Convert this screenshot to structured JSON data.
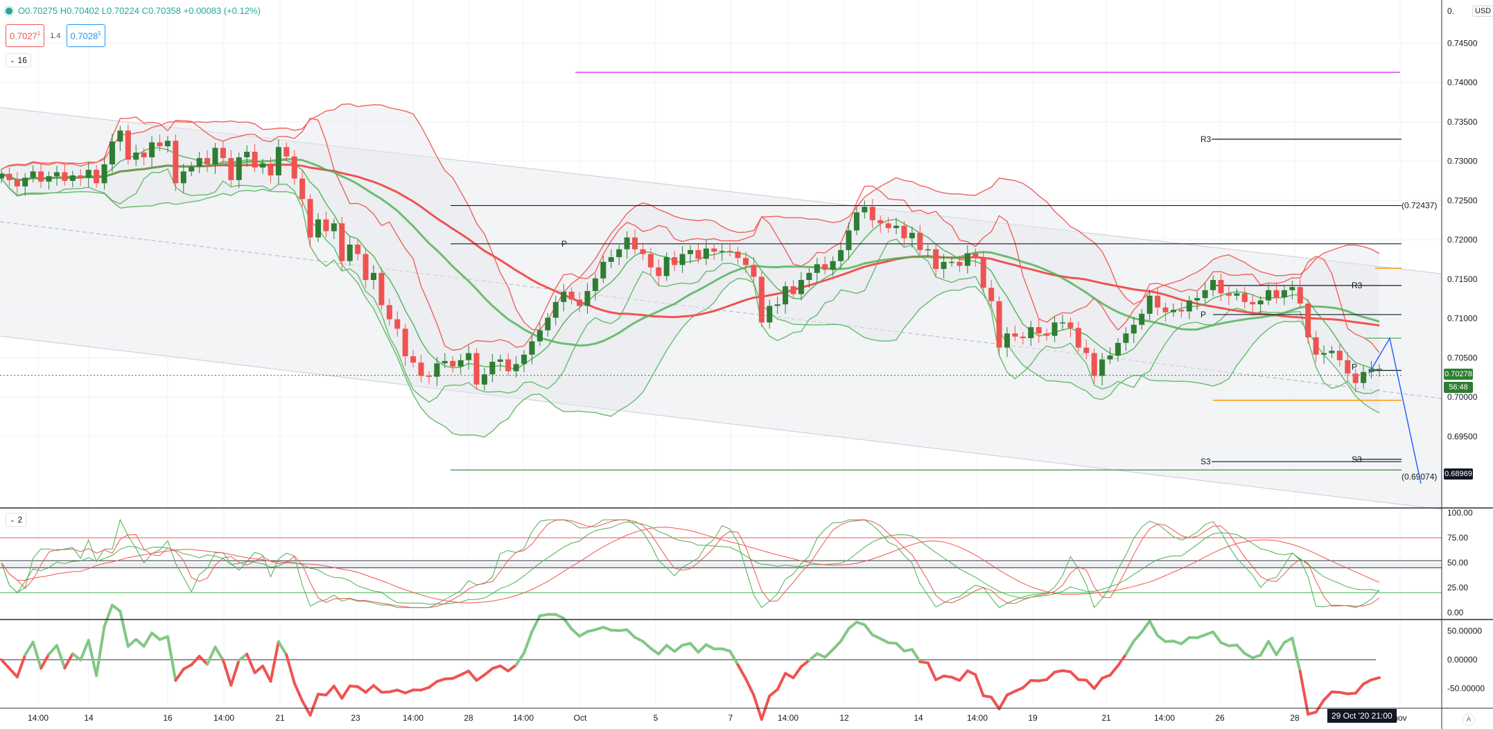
{
  "legend": {
    "open_label": "O",
    "open": "0.70275",
    "high_label": "H",
    "high": "0.70402",
    "low_label": "L",
    "low": "0.70224",
    "close_label": "C",
    "close": "0.70358",
    "change": "+0.00083 (+0.12%)",
    "bid": "0.7027",
    "bid_sup": "1",
    "spread": "1.4",
    "ask": "0.7028",
    "ask_sup": "5",
    "indicators_toggle": "16",
    "stoch_toggle": "2"
  },
  "price_axis": {
    "currency": "USD",
    "top_label": "0.",
    "labels": [
      "0.74500",
      "0.74000",
      "0.73500",
      "0.73000",
      "0.72500",
      "0.72000",
      "0.71500",
      "0.71000",
      "0.70500",
      "0.70000",
      "0.69500"
    ],
    "current_price": "0.70278",
    "countdown": "56:48",
    "low_tag": "0.68969",
    "auto": "A"
  },
  "stoch_axis": {
    "labels": [
      "100.00",
      "75.00",
      "50.00",
      "25.00",
      "0.00"
    ]
  },
  "cci_axis": {
    "labels": [
      "50.00000",
      "0.00000",
      "-50.00000"
    ]
  },
  "time_axis": {
    "labels": [
      "14:00",
      "14",
      "16",
      "14:00",
      "21",
      "23",
      "14:00",
      "28",
      "14:00",
      "Oct",
      "5",
      "7",
      "14:00",
      "12",
      "14",
      "14:00",
      "19",
      "21",
      "14:00",
      "26",
      "28",
      "nov"
    ],
    "cursor": "29 Oct '20   21:00"
  },
  "annotations": {
    "r3_left": "R3",
    "p_left": "P",
    "s3_left": "S3",
    "r3_right": "R3",
    "p_right": "P",
    "s3_right": "S3",
    "p_early": "P",
    "fib_high": "(0.72437)",
    "fib_low": "(0.69074)"
  },
  "colors": {
    "up": "#26a69a",
    "candle_up": "#2e7d32",
    "down": "#ef5350",
    "bb_upper": "#f0625a",
    "bb_lower": "#66bb6a",
    "ma_red": "#ef5350",
    "ma_green": "#4caf50",
    "channel_fill": "#eef0f3",
    "magenta": "#e040fb",
    "orange": "#ff9800",
    "blue": "#2962ff"
  },
  "chart_data": {
    "type": "candlestick",
    "symbol_quote": "USD",
    "ylim": [
      0.686,
      0.7505
    ],
    "levels": {
      "magenta": 0.7413,
      "R3": 0.7328,
      "fib_high": 0.72437,
      "P": 0.7195,
      "fib_low": 0.69074,
      "R3_recent": 0.7142,
      "P_recent": 0.7105,
      "S3_recent": 0.6921,
      "S3_left": 0.6918
    },
    "closes": [
      0.7284,
      0.7276,
      0.7268,
      0.7279,
      0.7287,
      0.7274,
      0.7281,
      0.7286,
      0.7275,
      0.7282,
      0.7279,
      0.7289,
      0.7272,
      0.7296,
      0.7325,
      0.7339,
      0.7302,
      0.7311,
      0.7305,
      0.7324,
      0.7319,
      0.7326,
      0.7272,
      0.7287,
      0.7293,
      0.7304,
      0.7296,
      0.7317,
      0.7304,
      0.7276,
      0.7305,
      0.7312,
      0.7292,
      0.7297,
      0.7282,
      0.7318,
      0.7306,
      0.7278,
      0.7252,
      0.7203,
      0.7226,
      0.7211,
      0.7221,
      0.7173,
      0.7194,
      0.7182,
      0.7149,
      0.7158,
      0.7117,
      0.7099,
      0.7087,
      0.7052,
      0.7044,
      0.7027,
      0.7026,
      0.7043,
      0.7046,
      0.7039,
      0.7047,
      0.7056,
      0.7016,
      0.7029,
      0.7045,
      0.7048,
      0.7033,
      0.7042,
      0.7054,
      0.7071,
      0.7085,
      0.7101,
      0.7121,
      0.7134,
      0.7124,
      0.7116,
      0.7135,
      0.7151,
      0.7172,
      0.7178,
      0.7188,
      0.7203,
      0.7188,
      0.7182,
      0.7165,
      0.7154,
      0.7178,
      0.7168,
      0.7182,
      0.7187,
      0.7176,
      0.7189,
      0.7185,
      0.7186,
      0.7185,
      0.7177,
      0.7168,
      0.7153,
      0.7095,
      0.7116,
      0.7118,
      0.7141,
      0.7131,
      0.7149,
      0.7158,
      0.7169,
      0.7162,
      0.7173,
      0.7187,
      0.7212,
      0.7235,
      0.7242,
      0.7225,
      0.7221,
      0.7215,
      0.7218,
      0.7202,
      0.7209,
      0.7187,
      0.7188,
      0.7163,
      0.7172,
      0.7172,
      0.7167,
      0.7183,
      0.7178,
      0.7139,
      0.7122,
      0.7063,
      0.7081,
      0.7077,
      0.7075,
      0.7089,
      0.7081,
      0.7078,
      0.7095,
      0.7095,
      0.7088,
      0.7063,
      0.7056,
      0.7027,
      0.7048,
      0.7053,
      0.7069,
      0.7081,
      0.7092,
      0.7106,
      0.7129,
      0.7114,
      0.7108,
      0.7111,
      0.7109,
      0.7123,
      0.7126,
      0.7136,
      0.7149,
      0.7132,
      0.7129,
      0.7132,
      0.7121,
      0.7118,
      0.7123,
      0.7136,
      0.7127,
      0.7136,
      0.714,
      0.7119,
      0.7076,
      0.7054,
      0.7056,
      0.7059,
      0.7047,
      0.703,
      0.7018,
      0.7032,
      0.7036,
      0.7036
    ]
  }
}
